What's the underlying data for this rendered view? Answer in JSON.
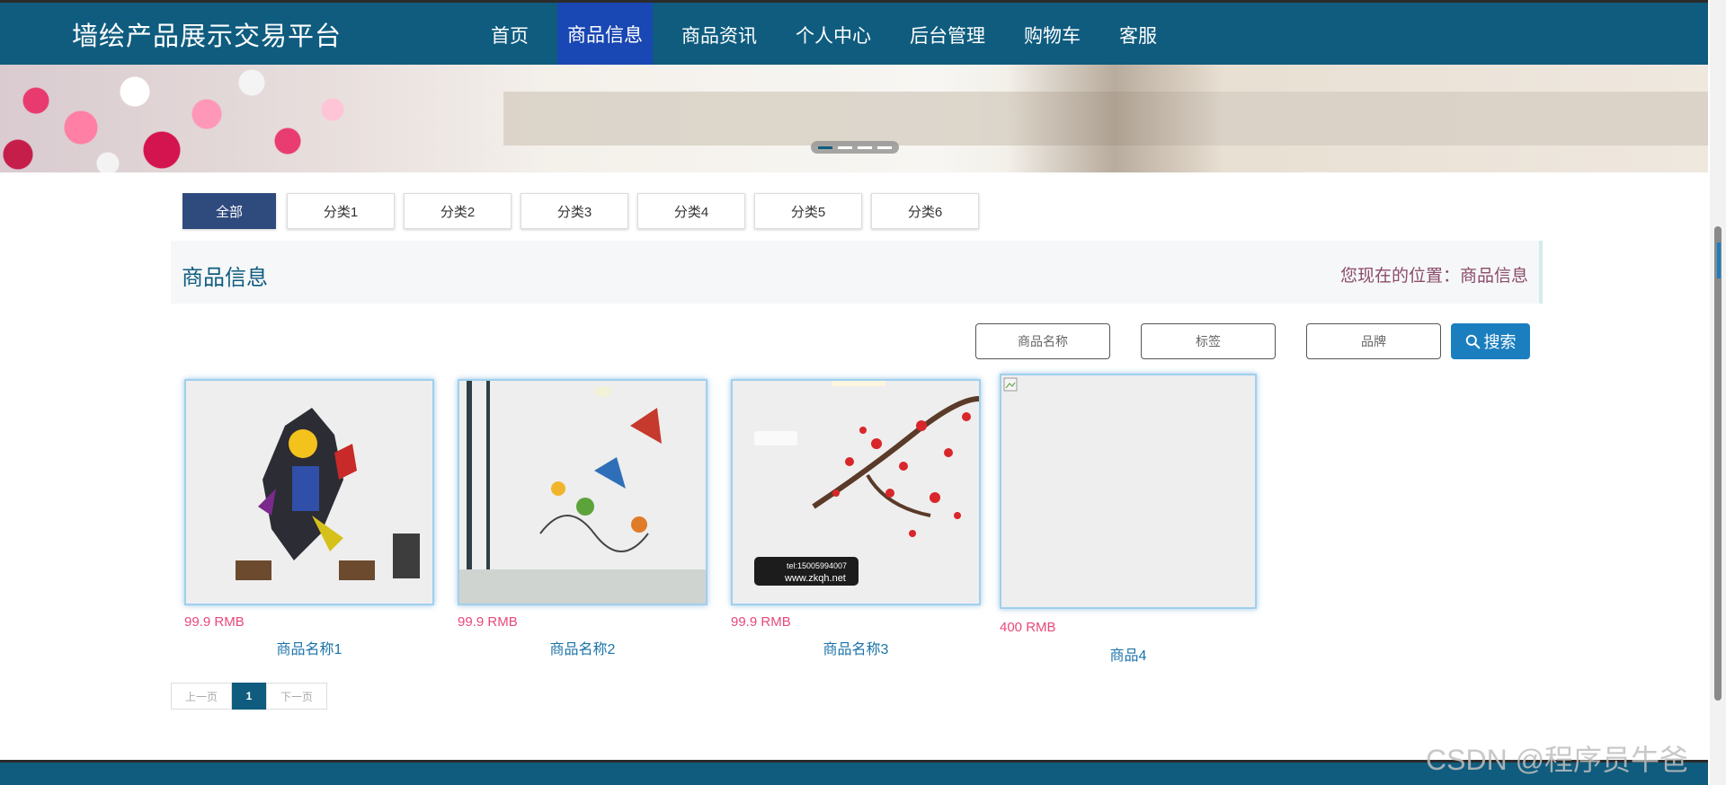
{
  "header": {
    "brand": "墙绘产品展示交易平台",
    "nav": [
      "首页",
      "商品信息",
      "商品资讯",
      "个人中心",
      "后台管理",
      "购物车",
      "客服"
    ],
    "active_nav": "商品信息"
  },
  "banner": {
    "slides": 4,
    "active_slide": 1
  },
  "categories": [
    "全部",
    "分类1",
    "分类2",
    "分类3",
    "分类4",
    "分类5",
    "分类6"
  ],
  "section": {
    "title": "商品信息",
    "breadcrumb": "您现在的位置：商品信息"
  },
  "search": {
    "name_placeholder": "商品名称",
    "tag_placeholder": "标签",
    "brand_placeholder": "品牌",
    "button_label": "搜索"
  },
  "products": [
    {
      "price": "99.9 RMB",
      "name": "商品名称1"
    },
    {
      "price": "99.9 RMB",
      "name": "商品名称2"
    },
    {
      "price": "99.9 RMB",
      "name": "商品名称3"
    },
    {
      "price": "400 RMB",
      "name": "商品4"
    }
  ],
  "product_images": {
    "3": {
      "tel": "tel:15005994007",
      "url": "www.zkqh.net"
    }
  },
  "pagination": {
    "prev": "上一页",
    "current": "1",
    "next": "下一页"
  },
  "watermark": "CSDN @程序员牛爸",
  "colors": {
    "primary": "#0f5c7f",
    "active_nav": "#1947b3",
    "category_active": "#2f4a7d",
    "price": "#e8497b",
    "search_button": "#1b7fbf"
  }
}
